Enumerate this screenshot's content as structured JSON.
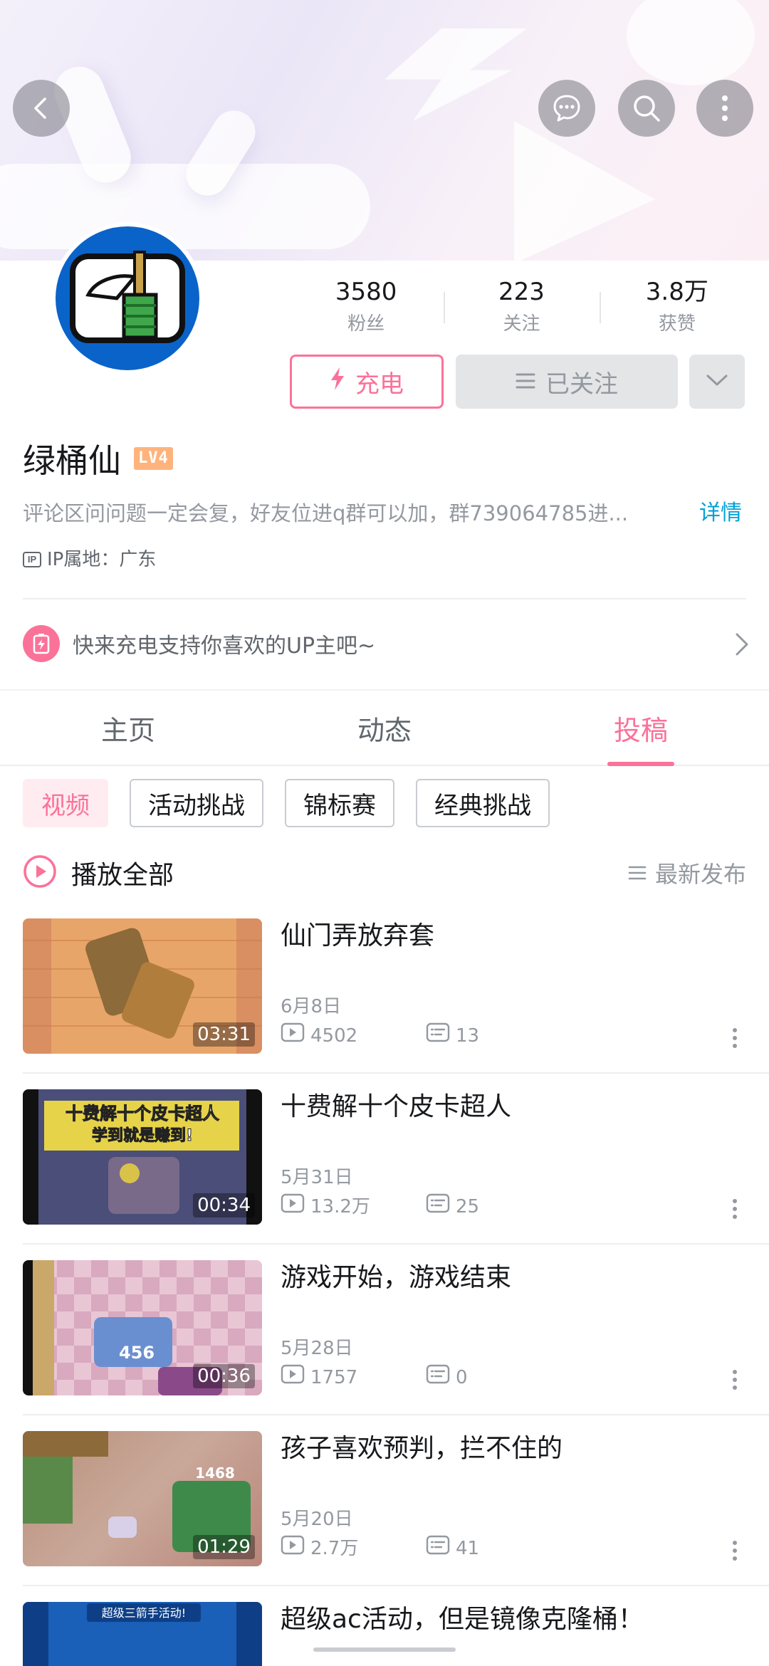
{
  "header": {
    "back_icon": "back-arrow-icon",
    "message_icon": "chat-bubble-icon",
    "search_icon": "search-icon",
    "more_icon": "vertical-ellipsis-icon"
  },
  "profile": {
    "username": "绿桶仙",
    "level": "LV4",
    "bio": "评论区问问题一定会复，好友位进q群可以加，群739064785进...",
    "bio_detail": "详情",
    "ip_location": "IP属地：广东",
    "stats": [
      {
        "value": "3580",
        "label": "粉丝"
      },
      {
        "value": "223",
        "label": "关注"
      },
      {
        "value": "3.8万",
        "label": "获赞"
      }
    ],
    "charge_button": "充电",
    "followed_button": "已关注"
  },
  "charge_banner": {
    "text": "快来充电支持你喜欢的UP主吧~"
  },
  "tabs": [
    "主页",
    "动态",
    "投稿"
  ],
  "active_tab": "投稿",
  "chips": [
    "视频",
    "活动挑战",
    "锦标赛",
    "经典挑战"
  ],
  "active_chip": "视频",
  "play_all": {
    "label": "播放全部",
    "sort_label": "最新发布"
  },
  "videos": [
    {
      "title": "仙门弄放弃套",
      "date": "6月8日",
      "views": "4502",
      "comments": "13",
      "duration": "03:31"
    },
    {
      "title": "十费解十个皮卡超人",
      "date": "5月31日",
      "views": "13.2万",
      "comments": "25",
      "duration": "00:34"
    },
    {
      "title": "游戏开始，游戏结束",
      "date": "5月28日",
      "views": "1757",
      "comments": "0",
      "duration": "00:36"
    },
    {
      "title": "孩子喜欢预判，拦不住的",
      "date": "5月20日",
      "views": "2.7万",
      "comments": "41",
      "duration": "01:29"
    },
    {
      "title": "超级ac活动，但是镜像克隆桶！",
      "date": "",
      "views": "",
      "comments": "",
      "duration": ""
    }
  ],
  "thumb_texts": {
    "v2_line1": "十费解十个皮卡超人",
    "v2_line2": "学到就是赚到!",
    "v3_num": "456",
    "v4_num": "1468",
    "v5_banner": "超级三箭手活动!"
  },
  "colors": {
    "accent": "#fb7299",
    "link": "#00a1d6",
    "text_secondary": "#9499a0"
  }
}
